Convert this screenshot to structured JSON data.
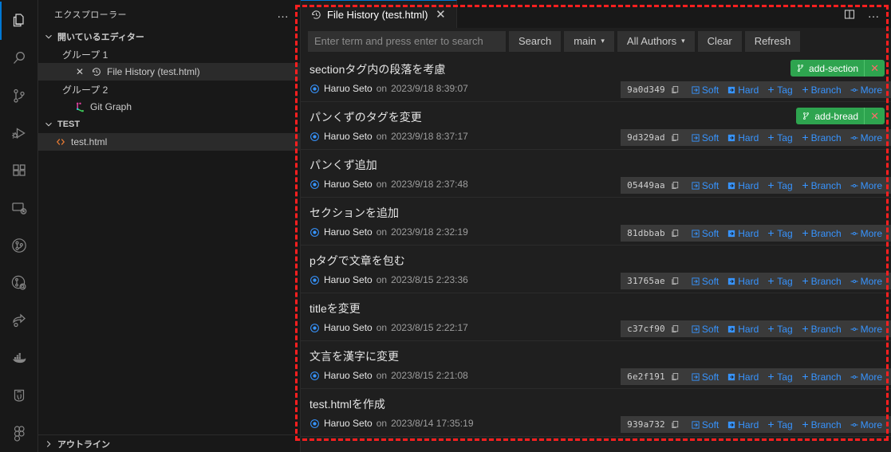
{
  "activitybar": {
    "items": [
      {
        "name": "explorer",
        "icon": "files-icon",
        "active": true
      },
      {
        "name": "search",
        "icon": "search-icon",
        "active": false
      },
      {
        "name": "source-control",
        "icon": "source-control-icon",
        "active": false
      },
      {
        "name": "run-and-debug",
        "icon": "run-debug-icon",
        "active": false
      },
      {
        "name": "extensions",
        "icon": "extensions-icon",
        "active": false
      },
      {
        "name": "remote-explorer",
        "icon": "remote-icon",
        "active": false
      },
      {
        "name": "git-graph",
        "icon": "git-graph-icon",
        "active": false
      },
      {
        "name": "git-history",
        "icon": "git-history-icon",
        "active": false
      },
      {
        "name": "share",
        "icon": "share-icon",
        "active": false
      },
      {
        "name": "docker",
        "icon": "docker-icon",
        "active": false
      },
      {
        "name": "postgresql",
        "icon": "postgres-elephant-icon",
        "active": false
      },
      {
        "name": "figma",
        "icon": "figma-icon",
        "active": false
      }
    ]
  },
  "sidebar": {
    "title": "エクスプローラー",
    "more_actions": "…",
    "open_editors": {
      "label": "開いているエディター",
      "groups": [
        {
          "label": "グループ 1",
          "items": [
            {
              "label": "File History (test.html)",
              "icon": "history-icon",
              "selected": true,
              "close": "✕"
            }
          ]
        },
        {
          "label": "グループ 2",
          "items": [
            {
              "label": "Git Graph",
              "icon": "git-graph-icon",
              "selected": false,
              "close": ""
            }
          ]
        }
      ]
    },
    "workspace": {
      "label": "TEST",
      "files": [
        {
          "label": "test.html",
          "icon": "html-icon",
          "selected": true
        }
      ]
    },
    "outline_label": "アウトライン"
  },
  "editor": {
    "tab": {
      "title": "File History (test.html)",
      "icon": "history-icon",
      "close": "✕"
    },
    "tab_actions": {
      "split_editor": "split-editor-icon",
      "more_actions": "…"
    },
    "toolbar": {
      "search_placeholder": "Enter term and press enter to search",
      "search_value": "",
      "search_button": "Search",
      "branch_select": "main",
      "authors_select": "All Authors",
      "clear_button": "Clear",
      "refresh_button": "Refresh",
      "caret": "▾"
    },
    "row_actions": {
      "copy_icon": "copy-hash-icon",
      "soft": "Soft",
      "hard": "Hard",
      "tag": "Tag",
      "branch": "Branch",
      "more": "More"
    },
    "commits": [
      {
        "subject": "sectionタグ内の段落を考慮",
        "author": "Haruo Seto",
        "on": "on",
        "date": "2023/9/18 8:39:07",
        "hash": "9a0d349",
        "ref": {
          "label": "add-section",
          "icon": "branch-icon",
          "close": "✕"
        }
      },
      {
        "subject": "パンくずのタグを変更",
        "author": "Haruo Seto",
        "on": "on",
        "date": "2023/9/18 8:37:17",
        "hash": "9d329ad",
        "ref": {
          "label": "add-bread",
          "icon": "branch-icon",
          "close": "✕"
        }
      },
      {
        "subject": "パンくず追加",
        "author": "Haruo Seto",
        "on": "on",
        "date": "2023/9/18 2:37:48",
        "hash": "05449aa",
        "ref": null
      },
      {
        "subject": "セクションを追加",
        "author": "Haruo Seto",
        "on": "on",
        "date": "2023/9/18 2:32:19",
        "hash": "81dbbab",
        "ref": null
      },
      {
        "subject": "pタグで文章を包む",
        "author": "Haruo Seto",
        "on": "on",
        "date": "2023/8/15 2:23:36",
        "hash": "31765ae",
        "ref": null
      },
      {
        "subject": "titleを変更",
        "author": "Haruo Seto",
        "on": "on",
        "date": "2023/8/15 2:22:17",
        "hash": "c37cf90",
        "ref": null
      },
      {
        "subject": "文言を漢字に変更",
        "author": "Haruo Seto",
        "on": "on",
        "date": "2023/8/15 2:21:08",
        "hash": "6e2f191",
        "ref": null
      },
      {
        "subject": "test.htmlを作成",
        "author": "Haruo Seto",
        "on": "on",
        "date": "2023/8/14 17:35:19",
        "hash": "939a732",
        "ref": null
      }
    ]
  },
  "colors": {
    "accent": "#0078d4",
    "link": "#3794ff",
    "branch_badge": "#2ea44f",
    "highlight_outline": "#ff1f1f",
    "editor_bg": "#1f1f1f",
    "sidebar_bg": "#181818"
  }
}
